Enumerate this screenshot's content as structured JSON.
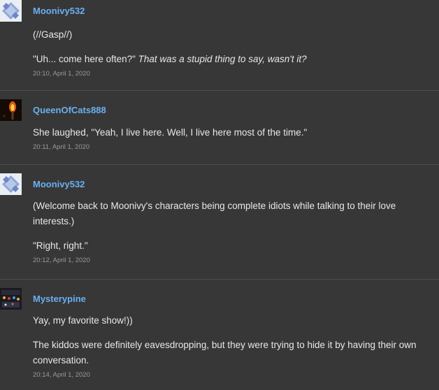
{
  "posts": [
    {
      "username": "Moonivy532",
      "avatar": "diamond-avatar-icon",
      "para1": "(//Gasp//)",
      "para2_a": "\"Uh... come here often?\" ",
      "para2_b": "That was a stupid thing to say, wasn't it?",
      "timestamp": "20:10, April 1, 2020"
    },
    {
      "username": "QueenOfCats888",
      "avatar": "torch-avatar-icon",
      "para1": "She laughed, \"Yeah, I live here. Well, I live here most of the time.\"",
      "timestamp": "20:11, April 1, 2020"
    },
    {
      "username": "Moonivy532",
      "avatar": "diamond-avatar-icon",
      "para1_line1": "(Welcome back to Moonivy's characters being complete idiots while talking to their love",
      "para1_line2": "interests.)",
      "para2": "\"Right, right.\"",
      "timestamp": "20:12, April 1, 2020"
    },
    {
      "username": "Mysterypine",
      "avatar": "lights-avatar-icon",
      "para1": "Yay, my favorite show!))",
      "para2_line1": "The kiddos were definitely eavesdropping, but they were trying to hide it by having their own",
      "para2_line2": "conversation.",
      "timestamp": "20:14, April 1, 2020"
    }
  ],
  "colors": {
    "background": "#373737",
    "username": "#6ab0f0",
    "text": "#e8e8e8",
    "timestamp": "#9a9a9a",
    "divider": "#4e4e4e"
  }
}
